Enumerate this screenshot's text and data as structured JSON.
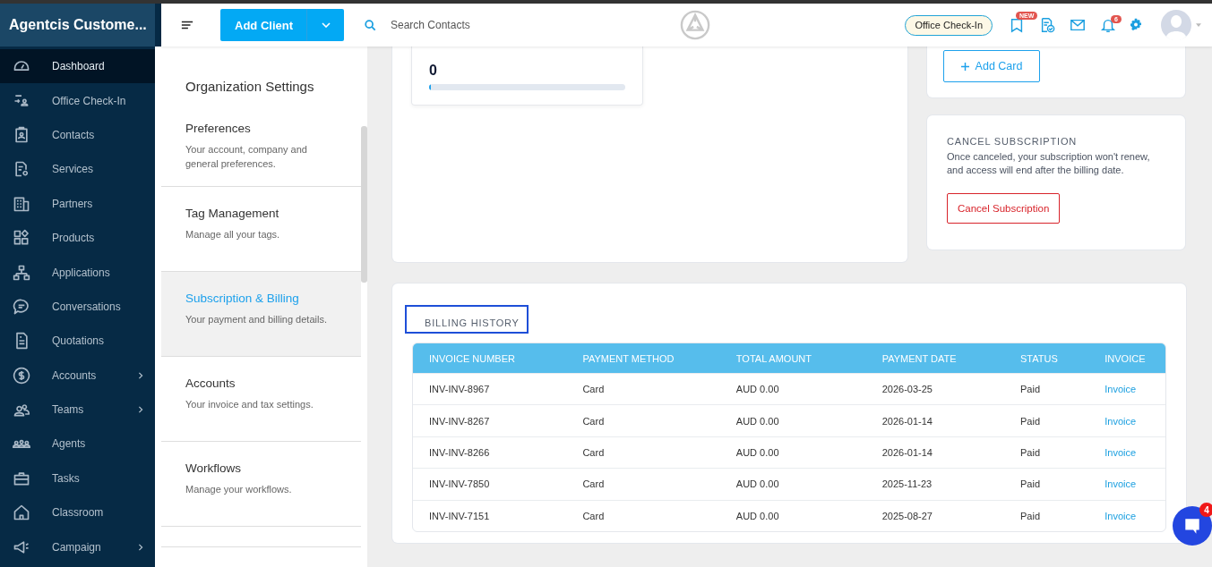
{
  "app_title": "Agentcis Custome...",
  "header": {
    "add_client": "Add Client",
    "search": {
      "placeholder": "Search Contacts"
    },
    "office_checkin": "Office Check-In",
    "new_badge": "NEW",
    "notification_count": "6"
  },
  "sidebar": {
    "items": [
      {
        "label": "Dashboard",
        "selected": true,
        "expandable": false
      },
      {
        "label": "Office Check-In",
        "selected": false,
        "expandable": false
      },
      {
        "label": "Contacts",
        "selected": false,
        "expandable": false
      },
      {
        "label": "Services",
        "selected": false,
        "expandable": false
      },
      {
        "label": "Partners",
        "selected": false,
        "expandable": false
      },
      {
        "label": "Products",
        "selected": false,
        "expandable": false
      },
      {
        "label": "Applications",
        "selected": false,
        "expandable": false
      },
      {
        "label": "Conversations",
        "selected": false,
        "expandable": false
      },
      {
        "label": "Quotations",
        "selected": false,
        "expandable": false
      },
      {
        "label": "Accounts",
        "selected": false,
        "expandable": true
      },
      {
        "label": "Teams",
        "selected": false,
        "expandable": true
      },
      {
        "label": "Agents",
        "selected": false,
        "expandable": false
      },
      {
        "label": "Tasks",
        "selected": false,
        "expandable": false
      },
      {
        "label": "Classroom",
        "selected": false,
        "expandable": false
      },
      {
        "label": "Campaign",
        "selected": false,
        "expandable": true
      }
    ]
  },
  "settings": {
    "title": "Organization Settings",
    "items": [
      {
        "title": "Preferences",
        "description": "Your account, company and general preferences.",
        "selected": false
      },
      {
        "title": "Tag Management",
        "description": "Manage all your tags.",
        "selected": false
      },
      {
        "title": "Subscription & Billing",
        "description": "Your payment and billing details.",
        "selected": true
      },
      {
        "title": "Accounts",
        "description": "Your invoice and tax settings.",
        "selected": false
      },
      {
        "title": "Workflows",
        "description": "Manage your workflows.",
        "selected": false
      }
    ]
  },
  "license_card": {
    "value": "0",
    "level": 0
  },
  "add_card_button": "Add Card",
  "cancel_card": {
    "title": "CANCEL SUBSCRIPTION",
    "text": "Once canceled, your subscription won't renew, and access will end after the billing date.",
    "button": "Cancel Subscription"
  },
  "billing_history": {
    "title": "BILLING HISTORY",
    "highlighted": true,
    "columns": [
      {
        "label": "INVOICE NUMBER",
        "kind": "text"
      },
      {
        "label": "PAYMENT METHOD",
        "kind": "text"
      },
      {
        "label": "TOTAL AMOUNT",
        "kind": "text"
      },
      {
        "label": "PAYMENT DATE",
        "kind": "text"
      },
      {
        "label": "STATUS",
        "kind": "text"
      },
      {
        "label": "INVOICE",
        "kind": "link"
      }
    ],
    "rows": [
      [
        "INV-INV-8967",
        "Card",
        "AUD 0.00",
        "2026-03-25",
        "Paid",
        "Invoice"
      ],
      [
        "INV-INV-8267",
        "Card",
        "AUD 0.00",
        "2026-01-14",
        "Paid",
        "Invoice"
      ],
      [
        "INV-INV-8266",
        "Card",
        "AUD 0.00",
        "2026-01-14",
        "Paid",
        "Invoice"
      ],
      [
        "INV-INV-7850",
        "Card",
        "AUD 0.00",
        "2025-11-23",
        "Paid",
        "Invoice"
      ],
      [
        "INV-INV-7151",
        "Card",
        "AUD 0.00",
        "2025-08-27",
        "Paid",
        "Invoice"
      ]
    ]
  },
  "chat": {
    "badge": "4"
  }
}
